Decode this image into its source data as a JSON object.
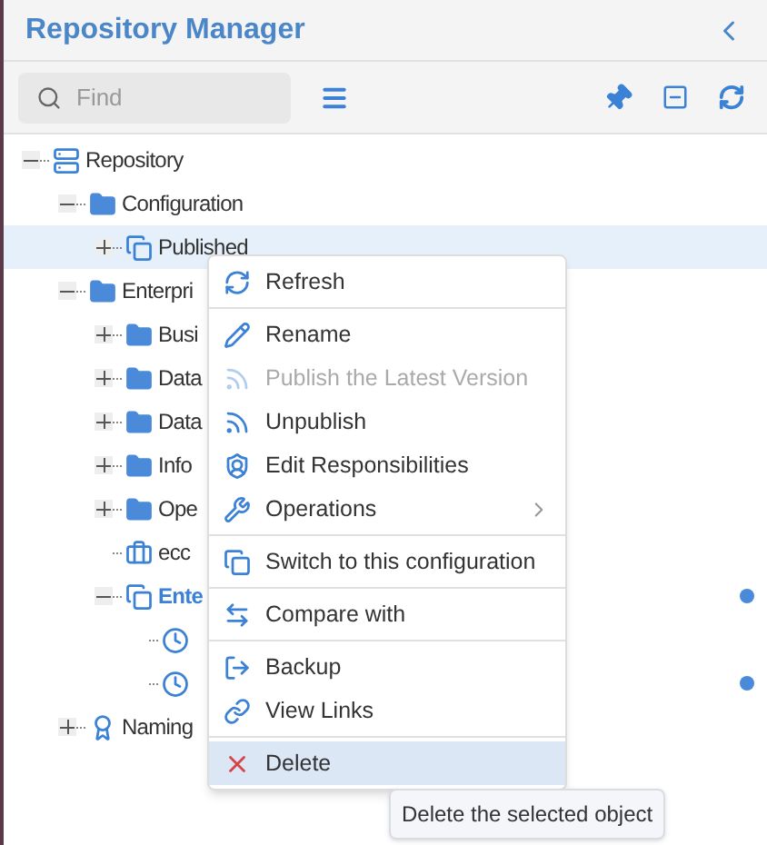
{
  "panel": {
    "title": "Repository Manager"
  },
  "toolbar": {
    "search": {
      "placeholder": "Find"
    }
  },
  "tree": [
    {
      "label": "Repository",
      "kind": "server",
      "expanded": true,
      "selected": false,
      "bold": false,
      "children": [
        {
          "label": "Configuration",
          "kind": "folder",
          "expanded": true,
          "selected": false,
          "bold": false,
          "children": [
            {
              "label": "Published",
              "kind": "documents",
              "expanded": false,
              "selected": true,
              "bold": false
            }
          ]
        },
        {
          "label": "Enterpri",
          "kind": "folder",
          "expanded": true,
          "selected": false,
          "bold": false,
          "children": [
            {
              "label": "Busi",
              "kind": "folder",
              "expanded": false,
              "selected": false,
              "bold": false
            },
            {
              "label": "Data",
              "kind": "folder",
              "expanded": false,
              "selected": false,
              "bold": false
            },
            {
              "label": "Data",
              "kind": "folder",
              "expanded": false,
              "selected": false,
              "bold": false
            },
            {
              "label": "Info",
              "kind": "folder",
              "expanded": false,
              "selected": false,
              "bold": false
            },
            {
              "label": "Ope",
              "kind": "folder",
              "expanded": false,
              "selected": false,
              "bold": false
            },
            {
              "label": "ecc",
              "kind": "briefcase",
              "selected": false,
              "bold": false
            },
            {
              "label": "Ente",
              "kind": "documents",
              "expanded": true,
              "selected": false,
              "bold": true,
              "dot": true,
              "children": [
                {
                  "kind": "clock",
                  "selected": false
                },
                {
                  "kind": "clock",
                  "selected": false,
                  "dot": true
                }
              ]
            }
          ]
        },
        {
          "label": "Naming",
          "kind": "badge",
          "expanded": false,
          "selected": false,
          "bold": false
        }
      ]
    }
  ],
  "context_menu": [
    [
      {
        "label": "Refresh",
        "kind": "refresh",
        "disabled": false,
        "selected": false,
        "submenu": false
      }
    ],
    [
      {
        "label": "Rename",
        "kind": "pencil",
        "disabled": false,
        "selected": false,
        "submenu": false
      },
      {
        "label": "Publish the Latest Version",
        "kind": "feed",
        "disabled": true,
        "selected": false,
        "submenu": false
      },
      {
        "label": "Unpublish",
        "kind": "feed",
        "disabled": false,
        "selected": false,
        "submenu": false
      },
      {
        "label": "Edit Responsibilities",
        "kind": "shield",
        "disabled": false,
        "selected": false,
        "submenu": false
      },
      {
        "label": "Operations",
        "kind": "wrench",
        "disabled": false,
        "selected": false,
        "submenu": true
      }
    ],
    [
      {
        "label": "Switch to this configuration",
        "kind": "documents",
        "disabled": false,
        "selected": false,
        "submenu": false
      }
    ],
    [
      {
        "label": "Compare with",
        "kind": "compare",
        "disabled": false,
        "selected": false,
        "submenu": false
      }
    ],
    [
      {
        "label": "Backup",
        "kind": "export",
        "disabled": false,
        "selected": false,
        "submenu": false
      },
      {
        "label": "View Links",
        "kind": "link",
        "disabled": false,
        "selected": false,
        "submenu": false
      }
    ],
    [
      {
        "label": "Delete",
        "kind": "delete",
        "disabled": false,
        "selected": true,
        "submenu": false
      }
    ]
  ],
  "tooltip": {
    "text": "Delete the selected object"
  }
}
